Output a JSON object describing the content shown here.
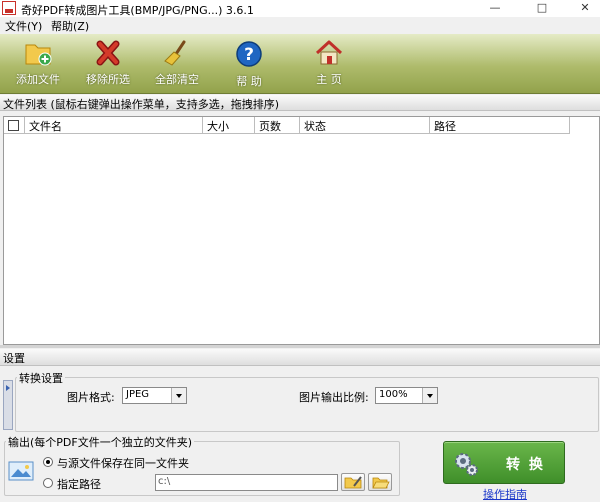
{
  "window": {
    "title": "奇好PDF转成图片工具(BMP/JPG/PNG...) 3.6.1",
    "minimize_glyph": "—",
    "maximize_glyph": "□",
    "close_glyph": "✕"
  },
  "menu": {
    "items": [
      {
        "label": "文件(Y)"
      },
      {
        "label": "帮助(Z)"
      }
    ]
  },
  "toolbar": {
    "buttons": [
      {
        "label": "添加文件",
        "icon": "add-folder-icon"
      },
      {
        "label": "移除所选",
        "icon": "remove-x-icon"
      },
      {
        "label": "全部清空",
        "icon": "broom-icon"
      },
      {
        "label": "帮 助",
        "icon": "help-icon"
      },
      {
        "label": "主 页",
        "icon": "home-icon"
      }
    ],
    "colors": {
      "gradient_top": "#e5ebc6",
      "gradient_bottom": "#92a24b"
    }
  },
  "file_list": {
    "caption": "文件列表   (鼠标右键弹出操作菜单，支持多选，拖拽排序)",
    "columns": [
      "文件名",
      "大小",
      "页数",
      "状态",
      "路径"
    ],
    "rows": []
  },
  "settings": {
    "caption": "设置",
    "conversion": {
      "group_title": "转换设置",
      "format_label": "图片格式:",
      "format_value": "JPEG",
      "ratio_label": "图片输出比例:",
      "ratio_value": "100%"
    },
    "output": {
      "group_title": "输出(每个PDF文件一个独立的文件夹)",
      "option_same": "与源文件保存在同一文件夹",
      "option_custom": "指定路径",
      "path_value": "c:\\",
      "selected": "same"
    }
  },
  "actions": {
    "convert_label": "转 换",
    "guide_link": "操作指南",
    "accent_color": "#4e9e35"
  }
}
